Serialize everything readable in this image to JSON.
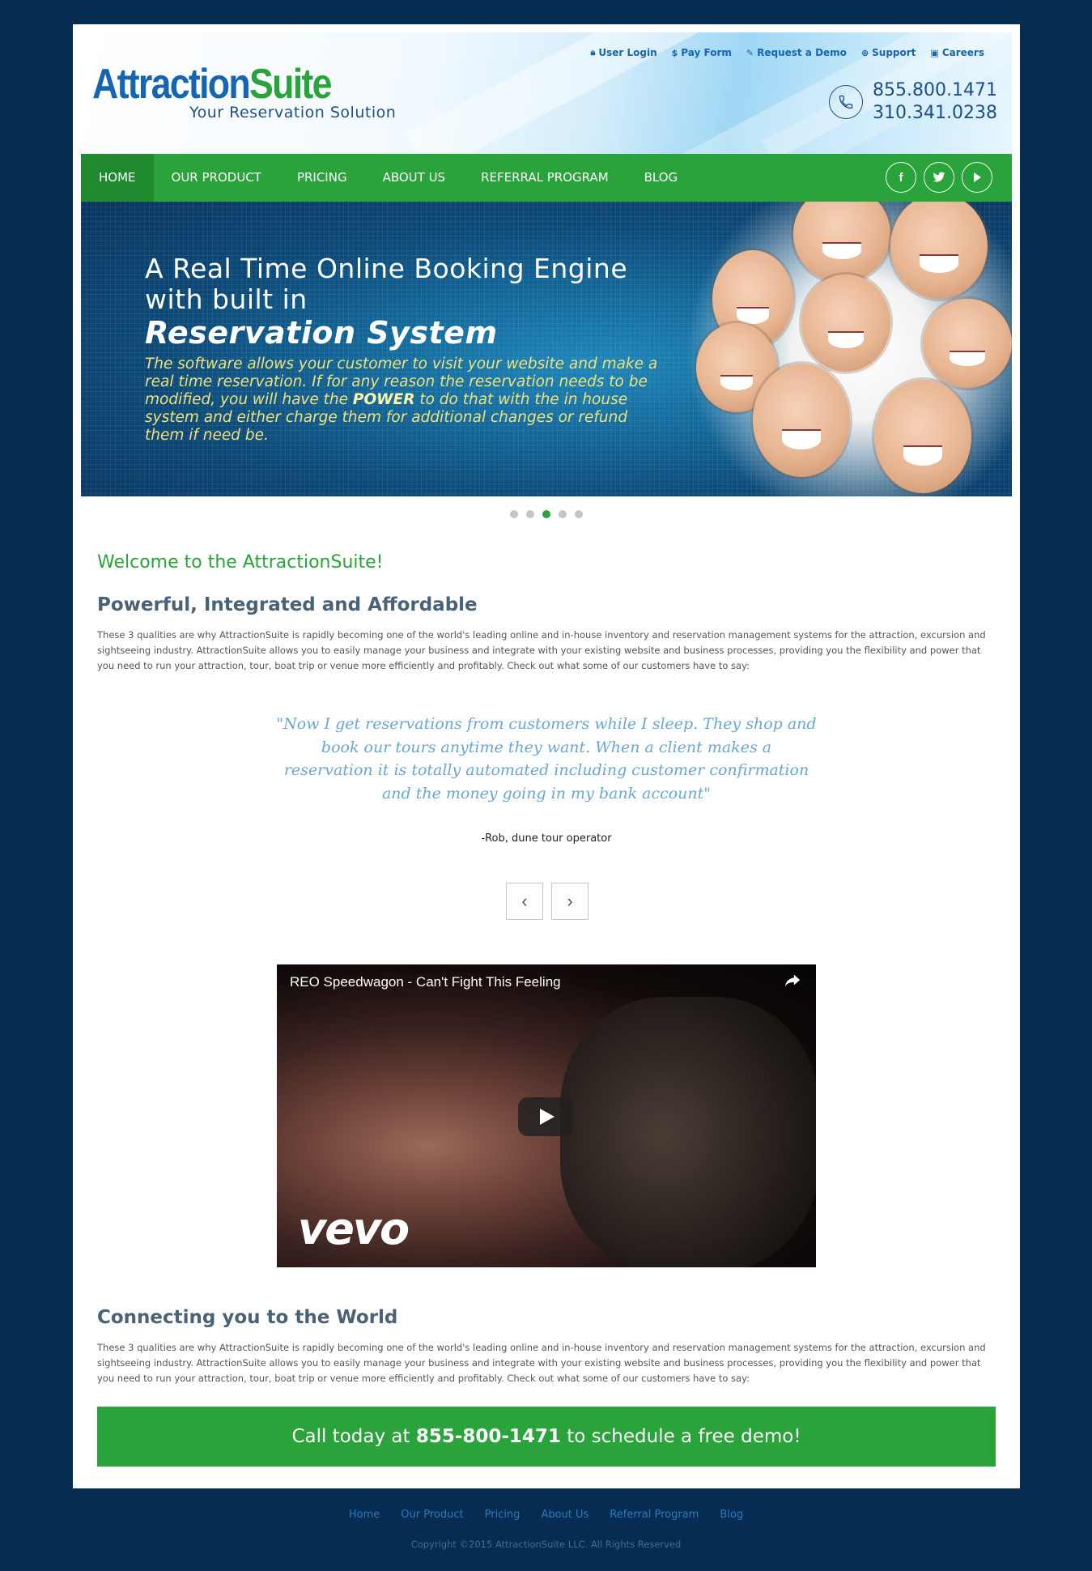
{
  "header": {
    "logo_part1": "Attraction",
    "logo_part2": "Suite",
    "tagline": "Your Reservation Solution",
    "top_links": [
      {
        "icon": "lock-icon",
        "label": "User Login"
      },
      {
        "icon": "dollar-icon",
        "label": "Pay Form"
      },
      {
        "icon": "edit-icon",
        "label": "Request a Demo"
      },
      {
        "icon": "lifebuoy-icon",
        "label": "Support"
      },
      {
        "icon": "briefcase-icon",
        "label": "Careers"
      }
    ],
    "phone1": "855.800.1471",
    "phone2": "310.341.0238"
  },
  "nav": {
    "items": [
      "HOME",
      "OUR PRODUCT",
      "PRICING",
      "ABOUT US",
      "REFERRAL PROGRAM",
      "BLOG"
    ],
    "active": "HOME",
    "social": [
      "facebook-icon",
      "twitter-icon",
      "youtube-icon"
    ]
  },
  "banner": {
    "headline_line1": "A Real Time Online Booking Engine",
    "headline_line2": "with built in",
    "headline_emphasis": "Reservation System",
    "body_before": "The software allows your customer to visit your website and make a real time reservation.  If for any reason the reservation needs to be modified, you will have the ",
    "body_bold": "POWER",
    "body_after": " to do that with the in house system and either charge them for additional changes or refund them if need be."
  },
  "carousel": {
    "count": 5,
    "active_index": 2
  },
  "welcome": "Welcome to the AttractionSuite!",
  "section1": {
    "heading": "Powerful, Integrated and Affordable",
    "text": "These 3 qualities are why AttractionSuite is rapidly becoming one of the world's leading online and in-house inventory and reservation management systems for the attraction, excursion and sightseeing industry. AttractionSuite allows you to easily manage your business and integrate with your existing website and business processes, providing you the flexibility and power that you need to run your attraction, tour, boat trip or venue more efficiently and profitably. Check out what some of our customers have to say:"
  },
  "testimonial": {
    "quote": "\"Now I get reservations from customers while I sleep. They shop and book our tours anytime they want. When a client makes a reservation it is totally automated including customer confirmation and the money going in my bank account\"",
    "author": "-Rob, dune tour operator",
    "prev": "‹",
    "next": "›"
  },
  "video": {
    "title": "REO Speedwagon - Can't Fight This Feeling",
    "watermark": "vevo"
  },
  "section2": {
    "heading": "Connecting you to the World",
    "text": "These 3 qualities are why AttractionSuite is rapidly becoming one of the world's leading online and in-house inventory and reservation management systems for the attraction, excursion and sightseeing industry. AttractionSuite allows you to easily manage your business and integrate with your existing website and business processes, providing you the flexibility and power that you need to run your attraction, tour, boat trip or venue more efficiently and profitably. Check out what some of our customers have to say:"
  },
  "cta": {
    "before": "Call today at ",
    "phone": "855-800-1471",
    "after": " to schedule a free demo!"
  },
  "footer": {
    "links": [
      "Home",
      "Our Product",
      "Pricing",
      "About Us",
      "Referral Program",
      "Blog"
    ],
    "copyright": "Copyright ©2015 AttractionSuite LLC. All Rights Reserved"
  },
  "colors": {
    "background": "#062c52",
    "brand_green": "#2aa43a",
    "brand_blue": "#1565b2"
  }
}
